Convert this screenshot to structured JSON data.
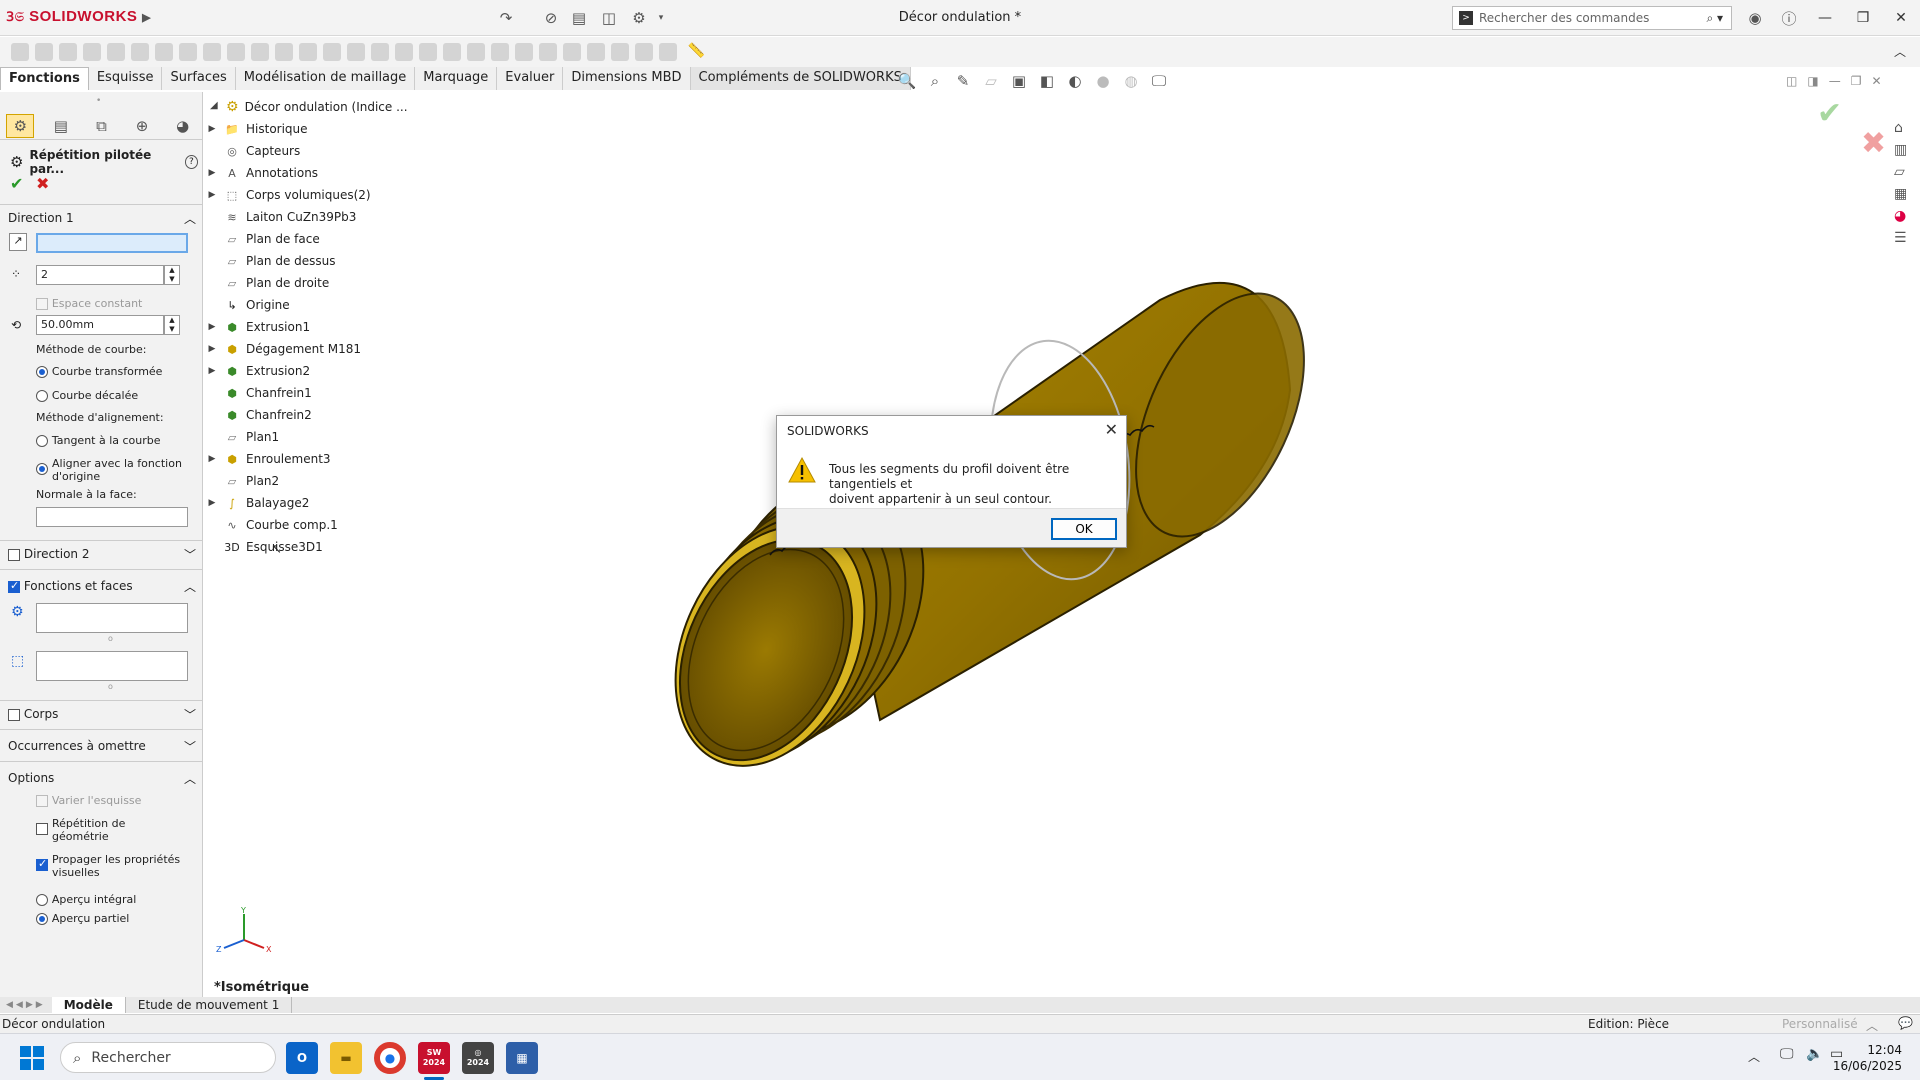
{
  "app": {
    "brand": "SOLIDWORKS",
    "doc_title": "Décor ondulation *"
  },
  "search": {
    "placeholder": "Rechercher des commandes"
  },
  "tabs": [
    {
      "label": "Fonctions"
    },
    {
      "label": "Esquisse"
    },
    {
      "label": "Surfaces"
    },
    {
      "label": "Modélisation de maillage"
    },
    {
      "label": "Marquage"
    },
    {
      "label": "Evaluer"
    },
    {
      "label": "Dimensions MBD"
    },
    {
      "label": "Compléments de SOLIDWORKS"
    }
  ],
  "property_manager": {
    "title": "Répétition pilotée par...",
    "direction1": {
      "header": "Direction 1",
      "count": "2",
      "constant_spacing": "Espace constant",
      "distance": "50.00mm",
      "curve_method_label": "Méthode de courbe:",
      "curve_transformed": "Courbe transformée",
      "curve_offset": "Courbe décalée",
      "align_method_label": "Méthode d'alignement:",
      "tangent": "Tangent à la courbe",
      "align_origin_1": "Aligner avec la fonction",
      "align_origin_2": "d'origine",
      "normal_face": "Normale à la face:"
    },
    "direction2": {
      "header": "Direction 2"
    },
    "features": {
      "header": "Fonctions et faces"
    },
    "bodies": {
      "header": "Corps"
    },
    "skip": {
      "header": "Occurrences à omettre"
    },
    "options": {
      "header": "Options",
      "vary_sketch": "Varier l'esquisse",
      "geom_pattern_1": "Répétition de",
      "geom_pattern_2": "géométrie",
      "propagate_1": "Propager les propriétés",
      "propagate_2": "visuelles",
      "full_preview": "Aperçu intégral",
      "partial_preview": "Aperçu partiel"
    }
  },
  "tree": {
    "root": "Décor ondulation (Indice ...",
    "items": [
      {
        "label": "Historique",
        "expand": true
      },
      {
        "label": "Capteurs",
        "expand": false
      },
      {
        "label": "Annotations",
        "expand": true
      },
      {
        "label": "Corps volumiques(2)",
        "expand": true
      },
      {
        "label": "Laiton CuZn39Pb3",
        "expand": false
      },
      {
        "label": "Plan de face",
        "expand": false
      },
      {
        "label": "Plan de dessus",
        "expand": false
      },
      {
        "label": "Plan de droite",
        "expand": false
      },
      {
        "label": "Origine",
        "expand": false
      },
      {
        "label": "Extrusion1",
        "expand": true
      },
      {
        "label": "Dégagement M181",
        "expand": true
      },
      {
        "label": "Extrusion2",
        "expand": true
      },
      {
        "label": "Chanfrein1",
        "expand": false
      },
      {
        "label": "Chanfrein2",
        "expand": false
      },
      {
        "label": "Plan1",
        "expand": false
      },
      {
        "label": "Enroulement3",
        "expand": true
      },
      {
        "label": "Plan2",
        "expand": false
      },
      {
        "label": "Balayage2",
        "expand": true
      },
      {
        "label": "Courbe comp.1",
        "expand": false
      },
      {
        "label": "Esquisse3D1",
        "expand": false
      }
    ]
  },
  "viewport": {
    "view_name": "*Isométrique"
  },
  "dialog": {
    "title": "SOLIDWORKS",
    "message_1": "Tous les segments du profil doivent être tangentiels et",
    "message_2": "doivent appartenir à un seul contour.",
    "ok": "OK"
  },
  "bottom_tabs": [
    {
      "label": "Modèle"
    },
    {
      "label": "Etude de mouvement 1"
    }
  ],
  "status": {
    "left": "Décor ondulation",
    "mode": "Edition: Pièce",
    "custom": "Personnalisé"
  },
  "taskbar": {
    "search": "Rechercher",
    "sw_badge": "2024",
    "time": "12:04",
    "date": "16/06/2025"
  },
  "colors": {
    "brass": "#9a7a05",
    "brass_dark": "#6b5200",
    "accent": "#0067c0",
    "brand": "#c8102e"
  }
}
